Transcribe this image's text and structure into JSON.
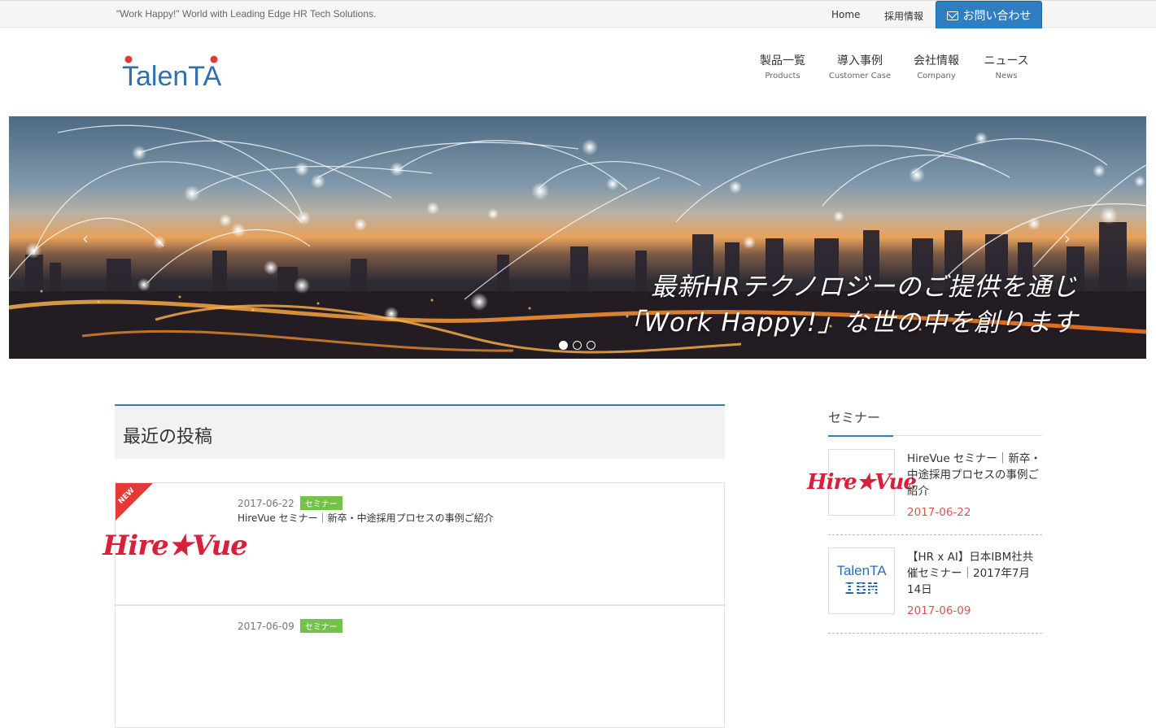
{
  "topbar": {
    "tagline": "\"Work Happy!\" World with Leading Edge HR Tech Solutions.",
    "home": "Home",
    "recruit": "採用情報",
    "contact": "お問い合わせ"
  },
  "brand": {
    "logo_text": "TalenTA",
    "colors": {
      "primary": "#2f7ec2",
      "accent": "#e53935",
      "category": "#75c24a"
    }
  },
  "nav": [
    {
      "label": "製品一覧",
      "sub": "Products"
    },
    {
      "label": "導入事例",
      "sub": "Customer Case"
    },
    {
      "label": "会社情報",
      "sub": "Company"
    },
    {
      "label": "ニュース",
      "sub": "News"
    }
  ],
  "hero": {
    "line1": "最新HRテクノロジーのご提供を通じ",
    "line2": "「Work Happy!」な世の中を創ります",
    "slide_count": 3,
    "active_slide": 1
  },
  "posts": {
    "heading": "最近の投稿",
    "items": [
      {
        "badge": "NEW",
        "date": "2017-06-22",
        "category": "セミナー",
        "title": "HireVue セミナー｜新卒・中途採用プロセスの事例ご紹介",
        "thumb": "Hire★Vue"
      },
      {
        "date": "2017-06-09",
        "category": "セミナー"
      }
    ]
  },
  "sidebar": {
    "title": "セミナー",
    "items": [
      {
        "title": "HireVue セミナー｜新卒・中途採用プロセスの事例ご紹介",
        "date": "2017-06-22",
        "thumb": "Hire★Vue"
      },
      {
        "title": "【HR x AI】日本IBM社共催セミナー｜2017年7月14日",
        "date": "2017-06-09",
        "thumb_top": "TalenTA",
        "thumb_bottom": "IBM"
      }
    ]
  }
}
